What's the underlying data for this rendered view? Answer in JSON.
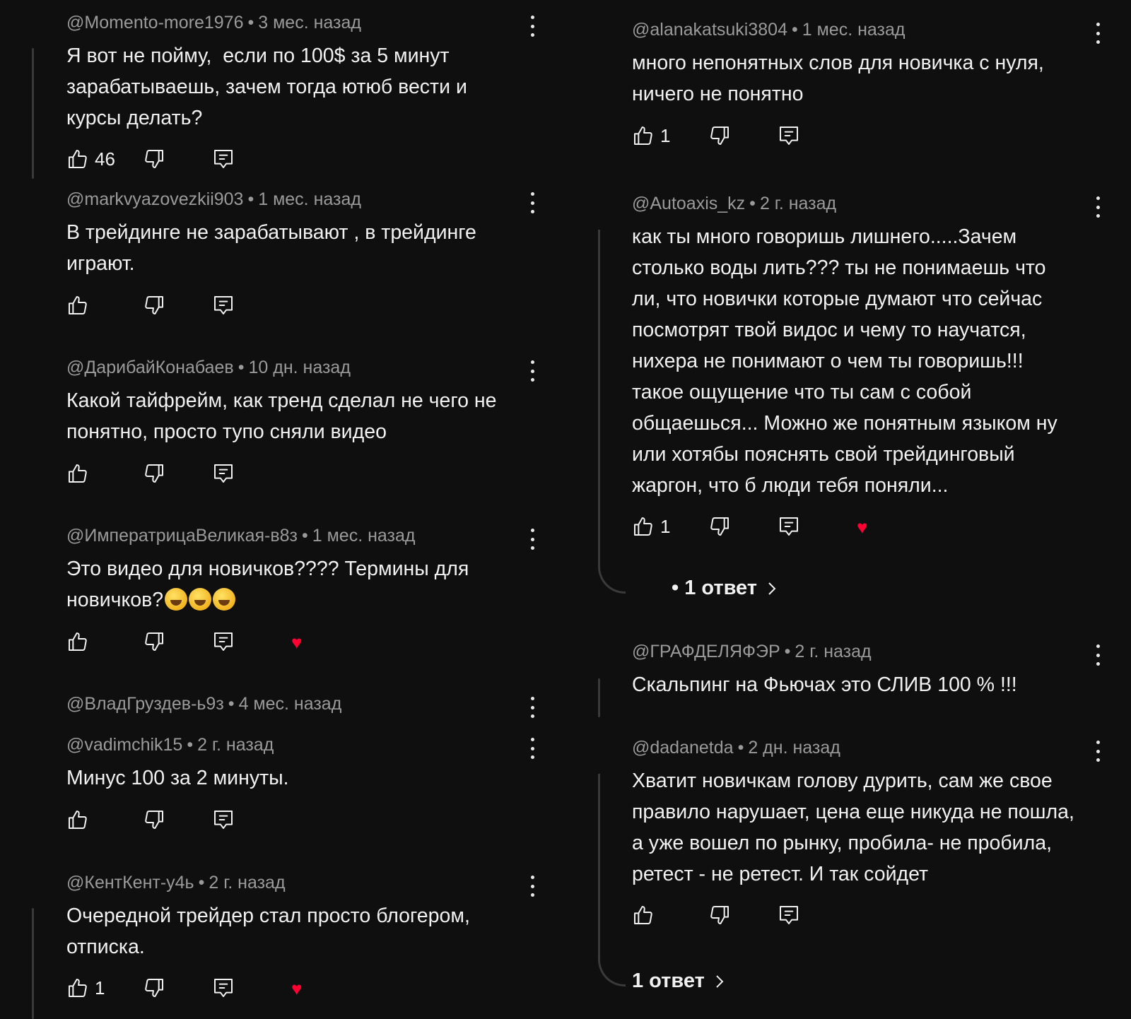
{
  "left": [
    {
      "author": "@Momento-more1976",
      "time": "3 мес. назад",
      "text": "Я вот не пойму,  если по 100$ за 5 минут\nзарабатываешь, зачем тогда ютюб вести и\nкурсы делать?",
      "likes": "46",
      "hearted": false
    },
    {
      "author": "@markvyazovezkii903",
      "time": "1 мес. назад",
      "text": "В трейдинге не зарабатывают , в трейдинге\nиграют.",
      "likes": "",
      "hearted": false
    },
    {
      "author": "@ДарибайКонабаев",
      "time": "10 дн. назад",
      "text": "Какой тайфрейм, как тренд сделал не чего не\nпонятно, просто тупо сняли видео",
      "likes": "",
      "hearted": false
    },
    {
      "author": "@ИмператрицаВеликая-в8з",
      "time": "1 мес. назад",
      "text": "Это видео для новичков???? Термины для\nновичков?",
      "likes": "",
      "hearted": true
    },
    {
      "author": "@ВладГруздев-ь9з",
      "time": "4 мес. назад",
      "text": "",
      "likes": "",
      "hearted": false
    },
    {
      "author": "@vadimchik15",
      "time": "2 г. назад",
      "text": "Минус 100 за 2 минуты.",
      "likes": "",
      "hearted": false
    },
    {
      "author": "@КентКент-у4ь",
      "time": "2 г. назад",
      "text": "Очередной трейдер стал просто блогером,\nотписка.",
      "likes": "1",
      "hearted": true
    }
  ],
  "right": [
    {
      "author": "@alanakatsuki3804",
      "time": "1 мес. назад",
      "text": "много непонятных слов для новичка с нуля,\nничего не понятно",
      "likes": "1",
      "hearted": false
    },
    {
      "author": "@Autoaxis_kz",
      "time": "2 г. назад",
      "text": "как ты много говоришь лишнего.....Зачем\nстолько воды лить??? ты не понимаешь что\nли, что новички которые думают что сейчас\nпосмотрят твой видос и чему то научатся,\nнихера не понимают о чем ты говоришь!!!\nтакое ощущение что ты сам с собой\nобщаешься... Можно же понятным языком ну\nили хотябы пояснять свой трейдинговый\nжаргон, что б люди тебя поняли...",
      "likes": "1",
      "hearted": true
    },
    {
      "author": "@ГРАФДЕЛЯФЭР",
      "time": "2 г. назад",
      "text": "Скальпинг на Фьючах это СЛИВ 100 % !!!",
      "likes": "",
      "hearted": false
    },
    {
      "author": "@dadanetda",
      "time": "2 дн. назад",
      "text": "Хватит новичкам голову дурить, сам же свое\nправило нарушает, цена еще никуда не пошла,\nа уже вошел по рынку, пробила- не пробила,\nретест - не ретест. И так сойдет",
      "likes": "",
      "hearted": false
    }
  ],
  "replies": [
    "• 1 ответ",
    "1 ответ"
  ],
  "separator": "•",
  "icons": {
    "like": "thumbs-up-icon",
    "dislike": "thumbs-down-icon",
    "reply": "reply-comment-icon",
    "more": "more-vert-icon",
    "heart": "heart-icon",
    "chevron": "chevron-right-icon",
    "emoji": "grinning-sweat-emoji"
  },
  "colors": {
    "background": "#0f0f0f",
    "text": "#f1f1f1",
    "meta": "#9a9a9a",
    "heart": "#ff0033",
    "thread_line": "#3a3a3a"
  }
}
